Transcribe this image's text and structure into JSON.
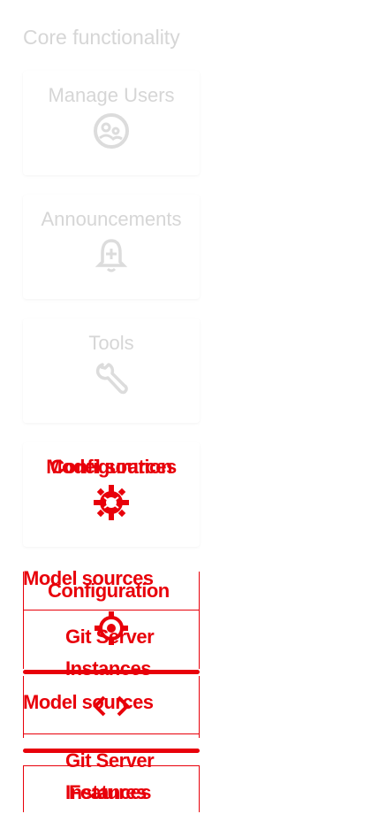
{
  "section": {
    "title": "Core functionality"
  },
  "cards": [
    {
      "label": "Manage Users",
      "icon": "manage-users-icon"
    },
    {
      "label": "Announcements",
      "icon": "bell-plus-icon"
    },
    {
      "label": "Tools",
      "icon": "wrench-icon"
    }
  ],
  "overlap": {
    "card4_label_a": "Configuration",
    "card4_label_b": "Model sources",
    "model_sources_1": "Model sources",
    "configuration_2": "Configuration",
    "git_server_1": "Git Server",
    "instances_1": "Instances",
    "model_sources_2": "Model sources",
    "git_server_2": "Git Server",
    "instances_2": "Instances",
    "features": "Features"
  },
  "colors": {
    "muted_text": "#d6d6d6",
    "accent_red": "#e8000a"
  }
}
